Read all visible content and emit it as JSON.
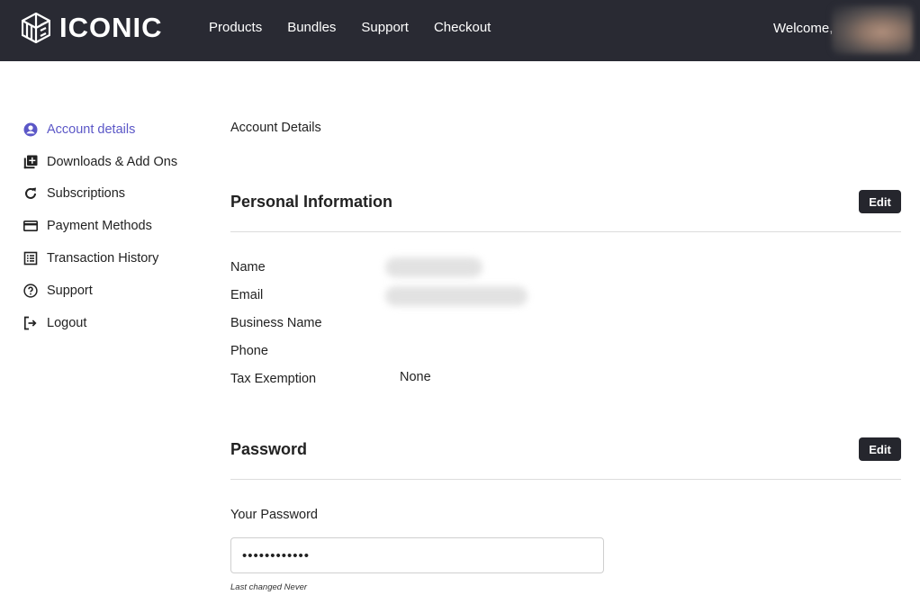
{
  "header": {
    "logo_text": "ICONIC",
    "nav": [
      "Products",
      "Bundles",
      "Support",
      "Checkout"
    ],
    "welcome": "Welcome,"
  },
  "sidebar": {
    "items": [
      {
        "label": "Account details",
        "icon": "user-circle-icon",
        "active": true
      },
      {
        "label": "Downloads & Add Ons",
        "icon": "library-add-icon",
        "active": false
      },
      {
        "label": "Subscriptions",
        "icon": "refresh-icon",
        "active": false
      },
      {
        "label": "Payment Methods",
        "icon": "credit-card-icon",
        "active": false
      },
      {
        "label": "Transaction History",
        "icon": "list-icon",
        "active": false
      },
      {
        "label": "Support",
        "icon": "help-circle-icon",
        "active": false
      },
      {
        "label": "Logout",
        "icon": "logout-icon",
        "active": false
      }
    ]
  },
  "main": {
    "page_title": "Account Details",
    "personal": {
      "title": "Personal Information",
      "edit_label": "Edit",
      "fields": {
        "name_label": "Name",
        "email_label": "Email",
        "business_label": "Business Name",
        "phone_label": "Phone",
        "tax_label": "Tax Exemption",
        "tax_value": "None"
      }
    },
    "password": {
      "title": "Password",
      "edit_label": "Edit",
      "field_label": "Your Password",
      "value": "••••••••••••",
      "note": "Last changed Never"
    }
  },
  "colors": {
    "header_bg": "#292a33",
    "accent": "#5b57c7",
    "button_bg": "#25262d"
  }
}
